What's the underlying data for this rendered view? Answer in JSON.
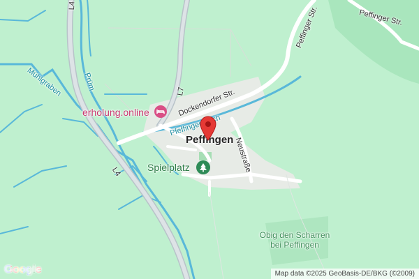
{
  "colors": {
    "land": "#bff0cf",
    "water": "#59b8d9",
    "road": "#ffffff",
    "highway": "#c8d1d6",
    "built_area": "#e7ebe6",
    "park": "#a7deb5",
    "pin": "#e53935",
    "poi_pink": "#d94f86",
    "poi_green": "#2e8b57"
  },
  "roads": {
    "l4_top": "L4",
    "l4_bottom": "L4",
    "l7": "L7",
    "dockendorfer": "Dockendorfer Str.",
    "peffinger_top": "Peffinger Str.",
    "peffinger_right": "Peffinger Str.",
    "neustrasse": "Neustraße"
  },
  "waterways": {
    "muehlgraben": "Mühlgraben",
    "pruem": "Prüm",
    "bach": "Pfeffinger Bach"
  },
  "places": {
    "town": "Peffingen",
    "hotel": "erholung.online",
    "playground": "Spielplatz",
    "area_name": "Obig den Scharren bei Peffingen"
  },
  "icons": {
    "hotel": "bed-icon",
    "playground": "tree-icon",
    "marker": "map-pin-icon"
  },
  "footer": {
    "logo": "Google",
    "attribution": "Map data ©2025 GeoBasis-DE/BKG (©2009)"
  }
}
